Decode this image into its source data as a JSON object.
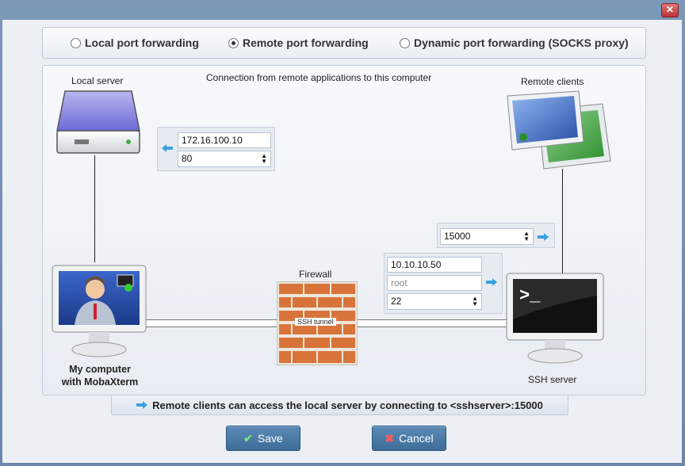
{
  "window": {
    "close_glyph": "✕"
  },
  "modes": [
    {
      "label": "Local port forwarding",
      "selected": false
    },
    {
      "label": "Remote port forwarding",
      "selected": true
    },
    {
      "label": "Dynamic port forwarding (SOCKS proxy)",
      "selected": false
    }
  ],
  "diagram": {
    "caption": "Connection from remote applications to this computer",
    "local_server_label": "Local server",
    "remote_clients_label": "Remote clients",
    "firewall_label": "Firewall",
    "ssh_tunnel_label": "SSH tunnel",
    "my_computer_line1": "My computer",
    "my_computer_line2": "with MobaXterm",
    "ssh_server_label": "SSH server",
    "local_host": "172.16.100.10",
    "local_port": "80",
    "remote_port": "15000",
    "ssh_host": "10.10.10.50",
    "ssh_user_placeholder": "root",
    "ssh_port": "22"
  },
  "status": {
    "text": "Remote clients can access the local server by connecting to <sshserver>:15000"
  },
  "buttons": {
    "save": "Save",
    "cancel": "Cancel"
  },
  "icons": [
    "close-icon",
    "server-icon",
    "remote-clients-icon",
    "computer-icon",
    "firewall-icon",
    "terminal-monitor-icon",
    "arrow-icon",
    "check-icon",
    "cross-icon"
  ],
  "colors": {
    "accent": "#4a7aa6",
    "arrow": "#3aa0e0"
  }
}
